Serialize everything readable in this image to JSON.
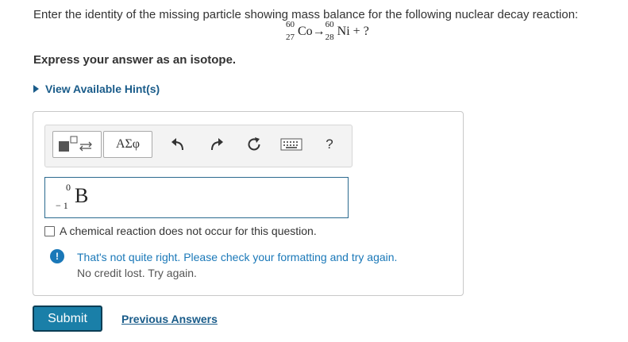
{
  "question": {
    "text": "Enter the identity of the missing particle showing mass balance for the following nuclear decay reaction:"
  },
  "equation": {
    "reactant": {
      "mass": "60",
      "atomic": "27",
      "symbol": "Co"
    },
    "arrow": "→",
    "product": {
      "mass": "60",
      "atomic": "28",
      "symbol": "Ni"
    },
    "plus": "+",
    "unknown": "?"
  },
  "instructions": {
    "express": "Express your answer as an isotope."
  },
  "hint": {
    "label": "View Available Hint(s)"
  },
  "toolbar": {
    "symbols_label": "ΑΣφ",
    "help_label": "?",
    "icons": [
      "templates-icon",
      "undo-icon",
      "redo-icon",
      "reset-icon",
      "keyboard-icon",
      "help-icon"
    ]
  },
  "answer": {
    "mass": "0",
    "atomic": "− 1",
    "symbol": "B"
  },
  "option": {
    "label": "A chemical reaction does not occur for this question."
  },
  "feedback": {
    "line1": "That's not quite right. Please check your formatting and try again.",
    "line2": "No credit lost. Try again.",
    "icon_label": "!"
  },
  "actions": {
    "submit_label": "Submit",
    "previous_label": "Previous Answers"
  },
  "colors": {
    "accent": "#1a7fa8",
    "link": "#1a5c8a",
    "feedback": "#1a78b8"
  }
}
